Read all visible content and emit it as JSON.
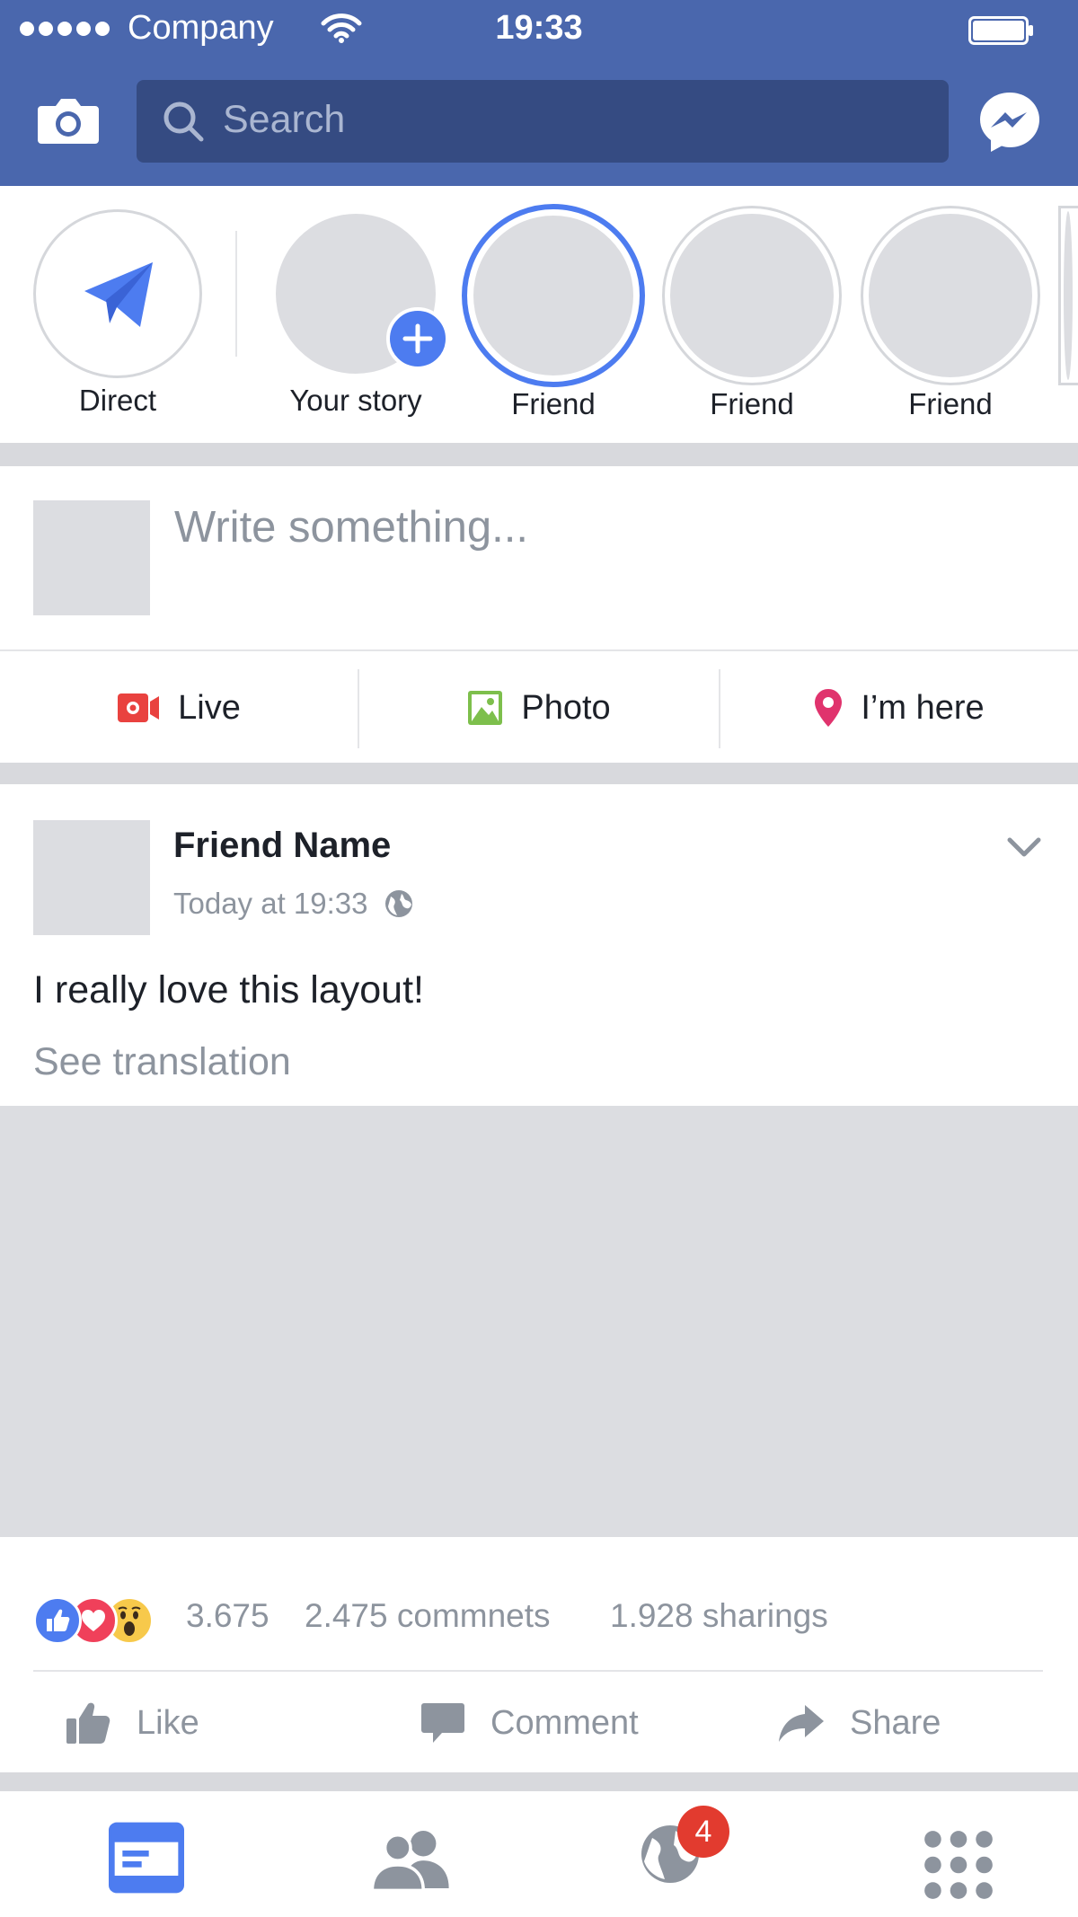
{
  "status_bar": {
    "carrier": "Company",
    "time": "19:33"
  },
  "search": {
    "placeholder": "Search"
  },
  "stories": {
    "direct_label": "Direct",
    "your_story_label": "Your story",
    "friends": [
      "Friend",
      "Friend",
      "Friend"
    ]
  },
  "composer": {
    "placeholder": "Write something...",
    "actions": {
      "live": "Live",
      "photo": "Photo",
      "checkin": "I’m here"
    }
  },
  "post": {
    "author": "Friend Name",
    "time": "Today at 19:33",
    "text": "I really love this layout!",
    "translate": "See translation",
    "reaction_count": "3.675",
    "comments": "2.475 commnets",
    "shares": "1.928 sharings",
    "buttons": {
      "like": "Like",
      "comment": "Comment",
      "share": "Share"
    }
  },
  "tabbar": {
    "notifications_badge": "4"
  },
  "colors": {
    "header": "#4a67ad",
    "search_bg": "#354b82",
    "accent": "#4d7cf0",
    "placeholder_gray": "#dcdde1",
    "separator": "#d8d9dd",
    "badge": "#e23b2f",
    "live_red": "#e9423f",
    "photo_green": "#7dbf4c",
    "pin_pink": "#e0336d"
  },
  "icons": {
    "status": [
      "signal-icon",
      "wifi-icon",
      "battery-icon"
    ],
    "header": [
      "camera-icon",
      "search-icon",
      "messenger-icon"
    ],
    "stories": [
      "paper-plane-icon",
      "plus-icon"
    ],
    "composer": [
      "video-camera-icon",
      "photo-icon",
      "location-pin-icon"
    ],
    "post": [
      "globe-icon",
      "chevron-down-icon",
      "like-reaction-icon",
      "love-reaction-icon",
      "wow-reaction-icon",
      "thumbs-up-icon",
      "comment-icon",
      "share-arrow-icon"
    ],
    "tabbar": [
      "news-feed-icon",
      "friends-icon",
      "notifications-globe-icon",
      "menu-grid-icon"
    ]
  }
}
